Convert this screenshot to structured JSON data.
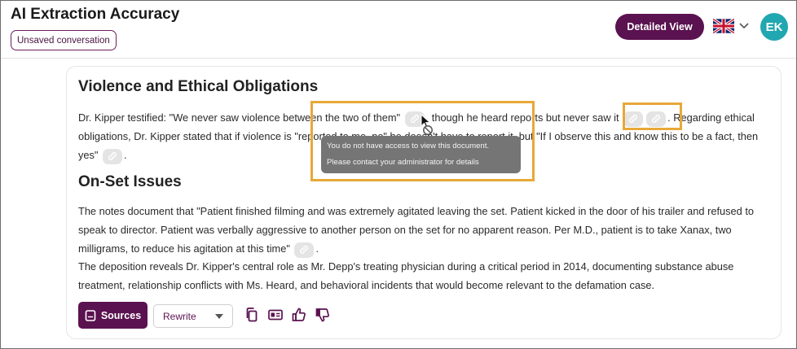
{
  "header": {
    "title": "AI Extraction Accuracy",
    "badge": "Unsaved conversation",
    "detailed_view_label": "Detailed View",
    "avatar_initials": "EK",
    "language_icon": "uk-flag-icon"
  },
  "section1": {
    "heading": "Violence and Ethical Obligations",
    "p1_a": "Dr. Kipper testified: \"We never saw violence between the two of them\"",
    "p1_b": ", though he heard reports but never saw it",
    "p1_c": ". Regarding ethical obligations, Dr. Kipper stated that if violence is \"reported to me, no\" he doesn't have to report it, but \"If I observe this and know this to be a fact, then yes\"",
    "p1_d": "."
  },
  "tooltip": {
    "line1": "You do not have access to view this document.",
    "line2": "Please contact your administrator for details"
  },
  "section2": {
    "heading": "On-Set Issues",
    "p2_a": "The notes document that \"Patient finished filming and was extremely agitated leaving the set. Patient kicked in the door of his trailer and refused to speak to director. Patient was verbally aggressive to another person on the set for no apparent reason. Per M.D., patient is to take Xanax, two milligrams, to reduce his agitation at this time\"",
    "p2_b": ".",
    "p3": "The deposition reveals Dr. Kipper's central role as Mr. Depp's treating physician during a critical period in 2014, documenting substance abuse treatment, relationship conflicts with Ms. Heard, and behavioral incidents that would become relevant to the defamation case."
  },
  "toolbar": {
    "sources_label": "Sources",
    "rewrite_label": "Rewrite",
    "icons": [
      "copy-icon",
      "id-card-icon",
      "thumbs-up-icon",
      "thumbs-down-icon"
    ]
  },
  "colors": {
    "brand": "#5b1250",
    "avatar": "#21a7b0",
    "highlight": "#e8a838",
    "tooltip_bg": "#757575"
  }
}
